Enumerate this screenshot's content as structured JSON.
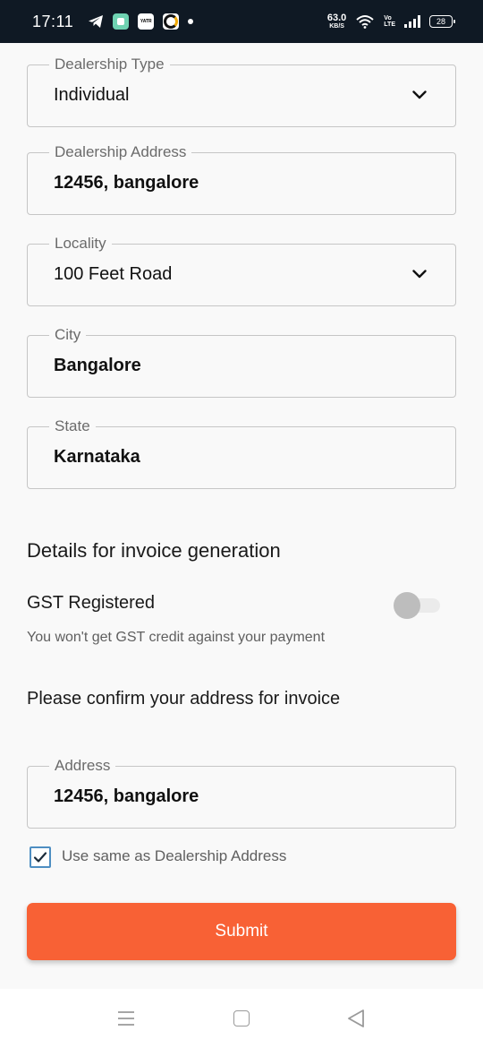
{
  "status_bar": {
    "time": "17:11",
    "app_badge_text": "YATR",
    "net_speed_value": "63.0",
    "net_speed_unit": "KB/S",
    "volte_top": "Vo",
    "volte_bottom": "LTE",
    "battery": "28"
  },
  "form": {
    "dealership_type": {
      "label": "Dealership Type",
      "value": "Individual",
      "icon": "chevron-down-icon"
    },
    "dealership_address": {
      "label": "Dealership Address",
      "value": "12456, bangalore"
    },
    "locality": {
      "label": "Locality",
      "value": "100 Feet Road",
      "icon": "chevron-down-icon"
    },
    "city": {
      "label": "City",
      "value": "Bangalore"
    },
    "state": {
      "label": "State",
      "value": "Karnataka"
    }
  },
  "invoice": {
    "section_title": "Details for invoice generation",
    "gst_label": "GST Registered",
    "gst_enabled": false,
    "gst_note": "You won't get GST credit against your payment",
    "confirm_text": "Please confirm your address for invoice",
    "address": {
      "label": "Address",
      "value": "12456, bangalore"
    },
    "same_as_checkbox_label": "Use same as Dealership Address",
    "same_as_checked": true
  },
  "submit_label": "Submit",
  "colors": {
    "accent": "#f86135",
    "checkbox": "#4e8ec2",
    "status_bar": "#0f1924"
  }
}
